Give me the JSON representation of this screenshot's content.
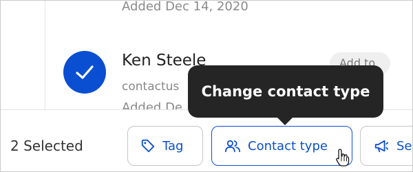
{
  "contacts": {
    "previous_added": "Added Dec 14, 2020",
    "current": {
      "name": "Ken Steele",
      "email": "contactus",
      "added": "Added De",
      "add_to_label": "Add to"
    }
  },
  "tooltip": {
    "text": "Change contact type"
  },
  "action_bar": {
    "selected_count": "2 Selected",
    "buttons": {
      "tag": "Tag",
      "contact_type": "Contact type",
      "send": "Se"
    }
  },
  "colors": {
    "accent": "#0a4fd1",
    "tooltip_bg": "#252525",
    "muted_text": "#8a8a8a"
  },
  "icons": {
    "check": "checkmark-icon",
    "tag": "tag-icon",
    "contact_type": "users-icon",
    "send": "megaphone-icon",
    "cursor": "hand-pointer-icon"
  }
}
